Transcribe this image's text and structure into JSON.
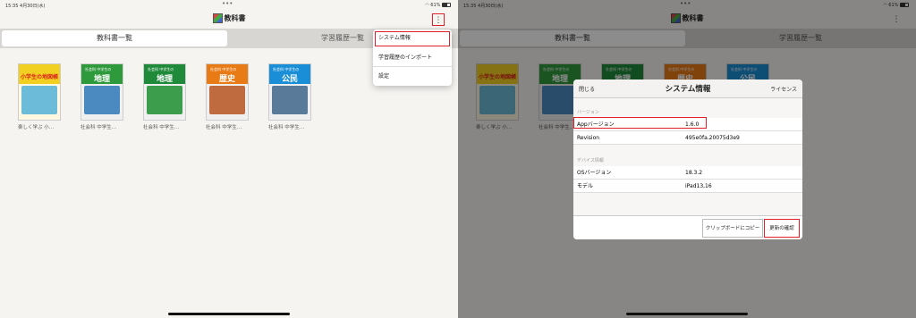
{
  "status": {
    "time": "15:35",
    "date": "4月30日(水)",
    "battery": "61%"
  },
  "app": {
    "title": "教科書"
  },
  "tabs": [
    {
      "label": "教科書一覧"
    },
    {
      "label": "学習履歴一覧"
    }
  ],
  "books": [
    {
      "label": "楽しく学ぶ 小…",
      "cover_subtitle": "",
      "cover_title": "小学生の地図帳",
      "band_color": "#f2d021",
      "image_color": "#6cbbd8"
    },
    {
      "label": "社会科 中学生…",
      "cover_subtitle": "社会科 中学生の",
      "cover_title": "地理",
      "band_color": "#2e9a3c",
      "image_color": "#4a8ac0"
    },
    {
      "label": "社会科 中学生…",
      "cover_subtitle": "社会科 中学生の",
      "cover_title": "地理",
      "band_color": "#1e8a3a",
      "image_color": "#3c9e4c"
    },
    {
      "label": "社会科 中学生…",
      "cover_subtitle": "社会科 中学生の",
      "cover_title": "歴史",
      "band_color": "#e97b16",
      "image_color": "#c06a40"
    },
    {
      "label": "社会科 中学生…",
      "cover_subtitle": "社会科 中学生の",
      "cover_title": "公民",
      "band_color": "#1a8ed6",
      "image_color": "#5a7a9a"
    }
  ],
  "menu": {
    "items": [
      {
        "label": "システム情報"
      },
      {
        "label": "学習履歴のインポート"
      },
      {
        "label": "設定"
      }
    ]
  },
  "dialog": {
    "close": "閉じる",
    "title": "システム情報",
    "license": "ライセンス",
    "version_section": "バージョン",
    "app_version_label": "Appバージョン",
    "app_version_value": "1.6.0",
    "revision_label": "Revision",
    "revision_value": "495e0fa.20075d3e9",
    "device_section": "デバイス情報",
    "os_label": "OSバージョン",
    "os_value": "18.3.2",
    "model_label": "モデル",
    "model_value": "iPad13,16",
    "copy_button": "クリップボードにコピー",
    "update_button": "更新の確認"
  },
  "colors": {
    "highlight": "#e0202a"
  },
  "icons": {
    "menu": "more-vertical-icon",
    "wifi": "wifi-icon",
    "battery": "battery-icon",
    "app_logo": "textbook-logo-icon"
  }
}
